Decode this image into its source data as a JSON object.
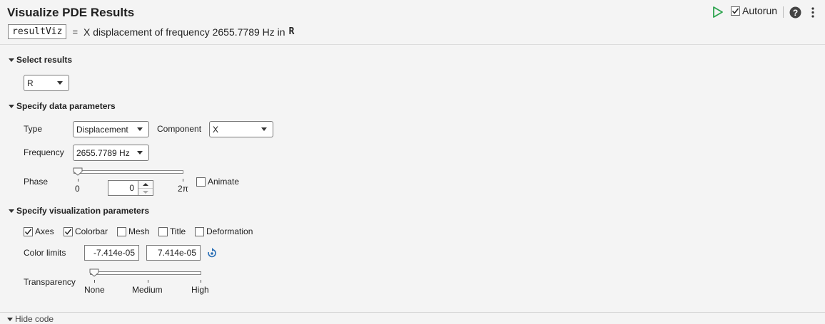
{
  "header": {
    "title": "Visualize PDE Results",
    "variable_name": "resultViz",
    "equals": "=",
    "description": "X displacement of frequency 2655.7789 Hz in",
    "source_var": "R",
    "autorun_label": "Autorun",
    "autorun_checked": true
  },
  "select_results": {
    "heading": "Select results",
    "selected": "R"
  },
  "data_params": {
    "heading": "Specify data parameters",
    "type_label": "Type",
    "type_value": "Displacement",
    "component_label": "Component",
    "component_value": "X",
    "frequency_label": "Frequency",
    "frequency_value": "2655.7789 Hz",
    "phase_label": "Phase",
    "phase_min_label": "0",
    "phase_max_label": "2π",
    "phase_value": "0",
    "animate_label": "Animate",
    "animate_checked": false
  },
  "viz_params": {
    "heading": "Specify visualization parameters",
    "checkboxes": [
      {
        "label": "Axes",
        "checked": true
      },
      {
        "label": "Colorbar",
        "checked": true
      },
      {
        "label": "Mesh",
        "checked": false
      },
      {
        "label": "Title",
        "checked": false
      },
      {
        "label": "Deformation",
        "checked": false
      }
    ],
    "color_limits_label": "Color limits",
    "color_limit_min": "-7.414e-05",
    "color_limit_max": "7.414e-05",
    "transparency_label": "Transparency",
    "transparency_ticks": [
      "None",
      "Medium",
      "High"
    ]
  },
  "footer": {
    "hide_code_label": "Hide code"
  },
  "colors": {
    "run_green": "#2ea44f",
    "refresh_blue": "#2a6fb6"
  },
  "icons": [
    "run-icon",
    "help-icon",
    "more-options-icon",
    "refresh-icon"
  ]
}
